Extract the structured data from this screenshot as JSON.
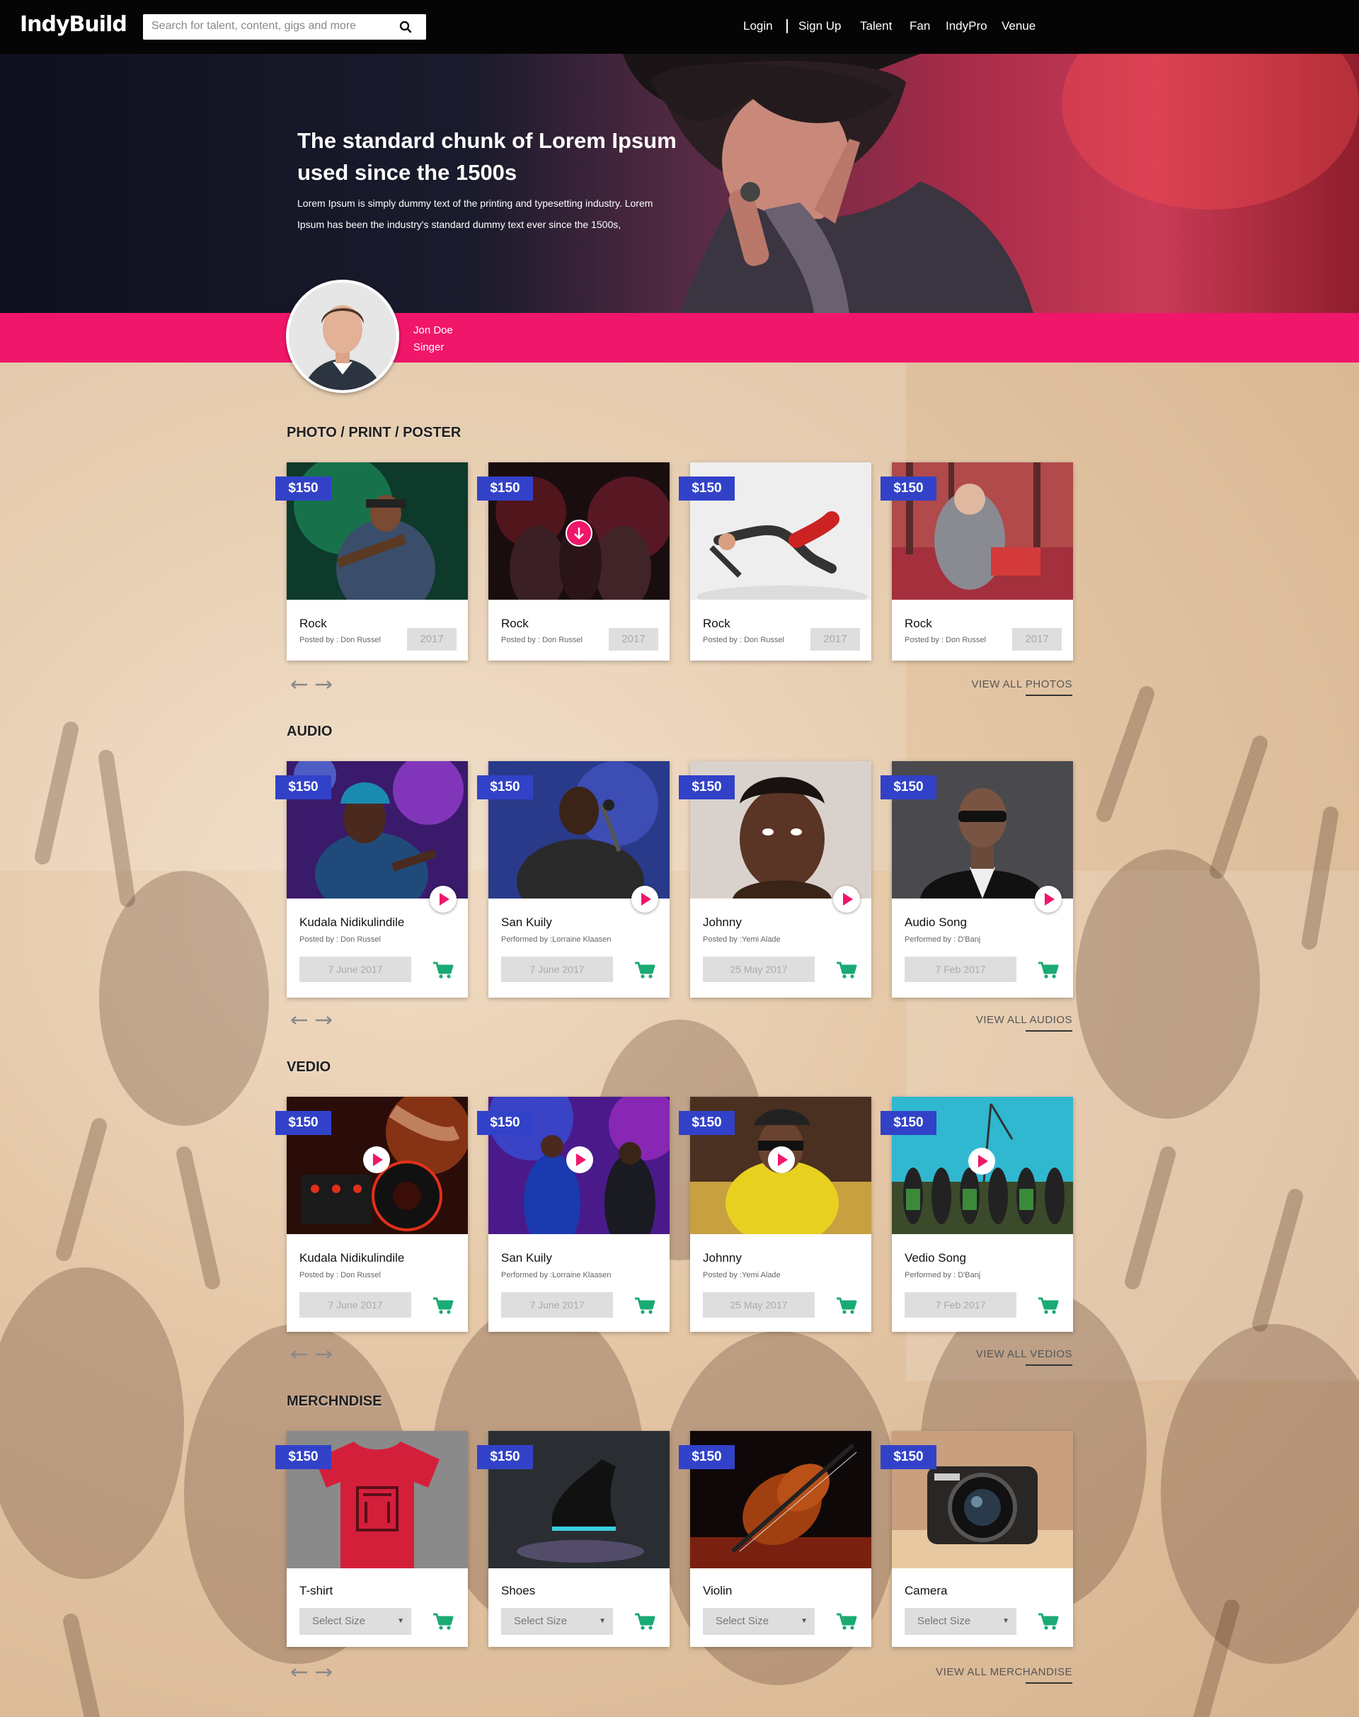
{
  "header": {
    "logo": "IndyBuild",
    "search_placeholder": "Search for talent, content, gigs and more",
    "nav": {
      "login": "Login",
      "signup": "Sign Up",
      "talent": "Talent",
      "fan": "Fan",
      "indypro": "IndyPro",
      "venue": "Venue"
    }
  },
  "hero": {
    "title": "The standard chunk of Lorem Ipsum used since the 1500s",
    "text": "Lorem Ipsum is simply dummy text of the printing and typesetting industry. Lorem Ipsum has been the industry's standard dummy text ever since the 1500s,"
  },
  "profile": {
    "name": "Jon Doe",
    "role": "Singer"
  },
  "colors": {
    "accent": "#f0166a",
    "price": "#3242c8",
    "cart": "#1aaa73"
  },
  "photos": {
    "title": "PHOTO / PRINT / POSTER",
    "view_all": "VIEW ALL PHOTOS",
    "items": [
      {
        "price": "$150",
        "title": "Rock",
        "posted": "Posted by : Don Russel",
        "year": "2017"
      },
      {
        "price": "$150",
        "title": "Rock",
        "posted": "Posted by : Don Russel",
        "year": "2017"
      },
      {
        "price": "$150",
        "title": "Rock",
        "posted": "Posted by : Don Russel",
        "year": "2017"
      },
      {
        "price": "$150",
        "title": "Rock",
        "posted": "Posted by : Don Russel",
        "year": "2017"
      }
    ]
  },
  "audio": {
    "title": "AUDIO",
    "view_all": "VIEW ALL AUDIOS",
    "items": [
      {
        "price": "$150",
        "title": "Kudala Nidikulindile",
        "by": "Posted by : Don Russel",
        "date": "7 June 2017"
      },
      {
        "price": "$150",
        "title": "San Kuily",
        "by": "Performed by :Lorraine Klaasen",
        "date": "7 June 2017"
      },
      {
        "price": "$150",
        "title": "Johnny",
        "by": "Posted by :Yemi Alade",
        "date": "25 May 2017"
      },
      {
        "price": "$150",
        "title": "Audio Song",
        "by": "Performed by : D'Banj",
        "date": "7 Feb 2017"
      }
    ]
  },
  "video": {
    "title": "VEDIO",
    "view_all": "VIEW ALL VEDIOS",
    "items": [
      {
        "price": "$150",
        "title": "Kudala Nidikulindile",
        "by": "Posted by : Don Russel",
        "date": "7 June 2017"
      },
      {
        "price": "$150",
        "title": "San Kuily",
        "by": "Performed by :Lorraine Klaasen",
        "date": "7 June 2017"
      },
      {
        "price": "$150",
        "title": "Johnny",
        "by": "Posted by :Yemi Alade",
        "date": "25 May 2017"
      },
      {
        "price": "$150",
        "title": "Vedio Song",
        "by": "Performed by : D'Banj",
        "date": "7 Feb 2017"
      }
    ]
  },
  "merch": {
    "title": "MERCHNDISE",
    "view_all": "VIEW ALL MERCHANDISE",
    "items": [
      {
        "price": "$150",
        "title": "T-shirt",
        "select": "Select Size"
      },
      {
        "price": "$150",
        "title": "Shoes",
        "select": "Select Size"
      },
      {
        "price": "$150",
        "title": "Violin",
        "select": "Select Size"
      },
      {
        "price": "$150",
        "title": "Camera",
        "select": "Select Size"
      }
    ]
  }
}
